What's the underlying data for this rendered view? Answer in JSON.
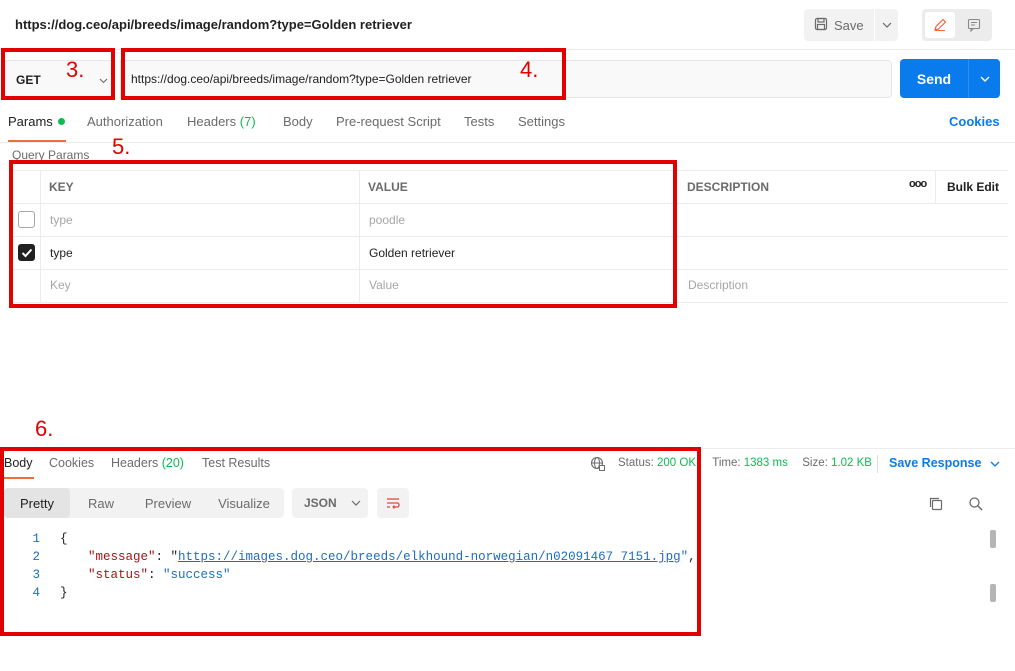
{
  "request": {
    "title": "https://dog.ceo/api/breeds/image/random?type=Golden retriever",
    "save_label": "Save",
    "method": "GET",
    "url": "https://dog.ceo/api/breeds/image/random?type=Golden retriever",
    "send_label": "Send"
  },
  "request_tabs": {
    "params": "Params",
    "authorization": "Authorization",
    "headers": "Headers",
    "headers_count": "(7)",
    "body": "Body",
    "pre_request": "Pre-request Script",
    "tests": "Tests",
    "settings": "Settings",
    "cookies": "Cookies"
  },
  "query_params": {
    "label": "Query Params",
    "columns": {
      "key": "KEY",
      "value": "VALUE",
      "description": "DESCRIPTION",
      "more": "ooo",
      "bulk_edit": "Bulk Edit"
    },
    "rows": [
      {
        "checked": false,
        "key": "type",
        "value": "poodle",
        "disabled": true
      },
      {
        "checked": true,
        "key": "type",
        "value": "Golden retriever",
        "disabled": false
      }
    ],
    "new_row": {
      "key": "Key",
      "value": "Value",
      "description": "Description"
    }
  },
  "annotations": {
    "a3": "3.",
    "a4": "4.",
    "a5": "5.",
    "a6": "6."
  },
  "response": {
    "tabs": {
      "body": "Body",
      "cookies": "Cookies",
      "headers": "Headers",
      "headers_count": "(20)",
      "test_results": "Test Results"
    },
    "status_label": "Status:",
    "status_value": "200 OK",
    "time_label": "Time:",
    "time_value": "1383 ms",
    "size_label": "Size:",
    "size_value": "1.02 KB",
    "save_response": "Save Response",
    "formats": {
      "pretty": "Pretty",
      "raw": "Raw",
      "preview": "Preview",
      "visualize": "Visualize"
    },
    "language": "JSON",
    "code": {
      "line_numbers": [
        "1",
        "2",
        "3",
        "4"
      ],
      "open_brace": "{",
      "close_brace": "}",
      "message_key": "\"message\"",
      "message_value": "https://images.dog.ceo/breeds/elkhound-norwegian/n02091467_7151.jpg",
      "status_key": "\"status\"",
      "status_value": "\"success\""
    }
  },
  "colors": {
    "accent": "#097bed",
    "tab_underline": "#f26b3a",
    "success": "#0cbb52",
    "annotation": "#e30000"
  }
}
